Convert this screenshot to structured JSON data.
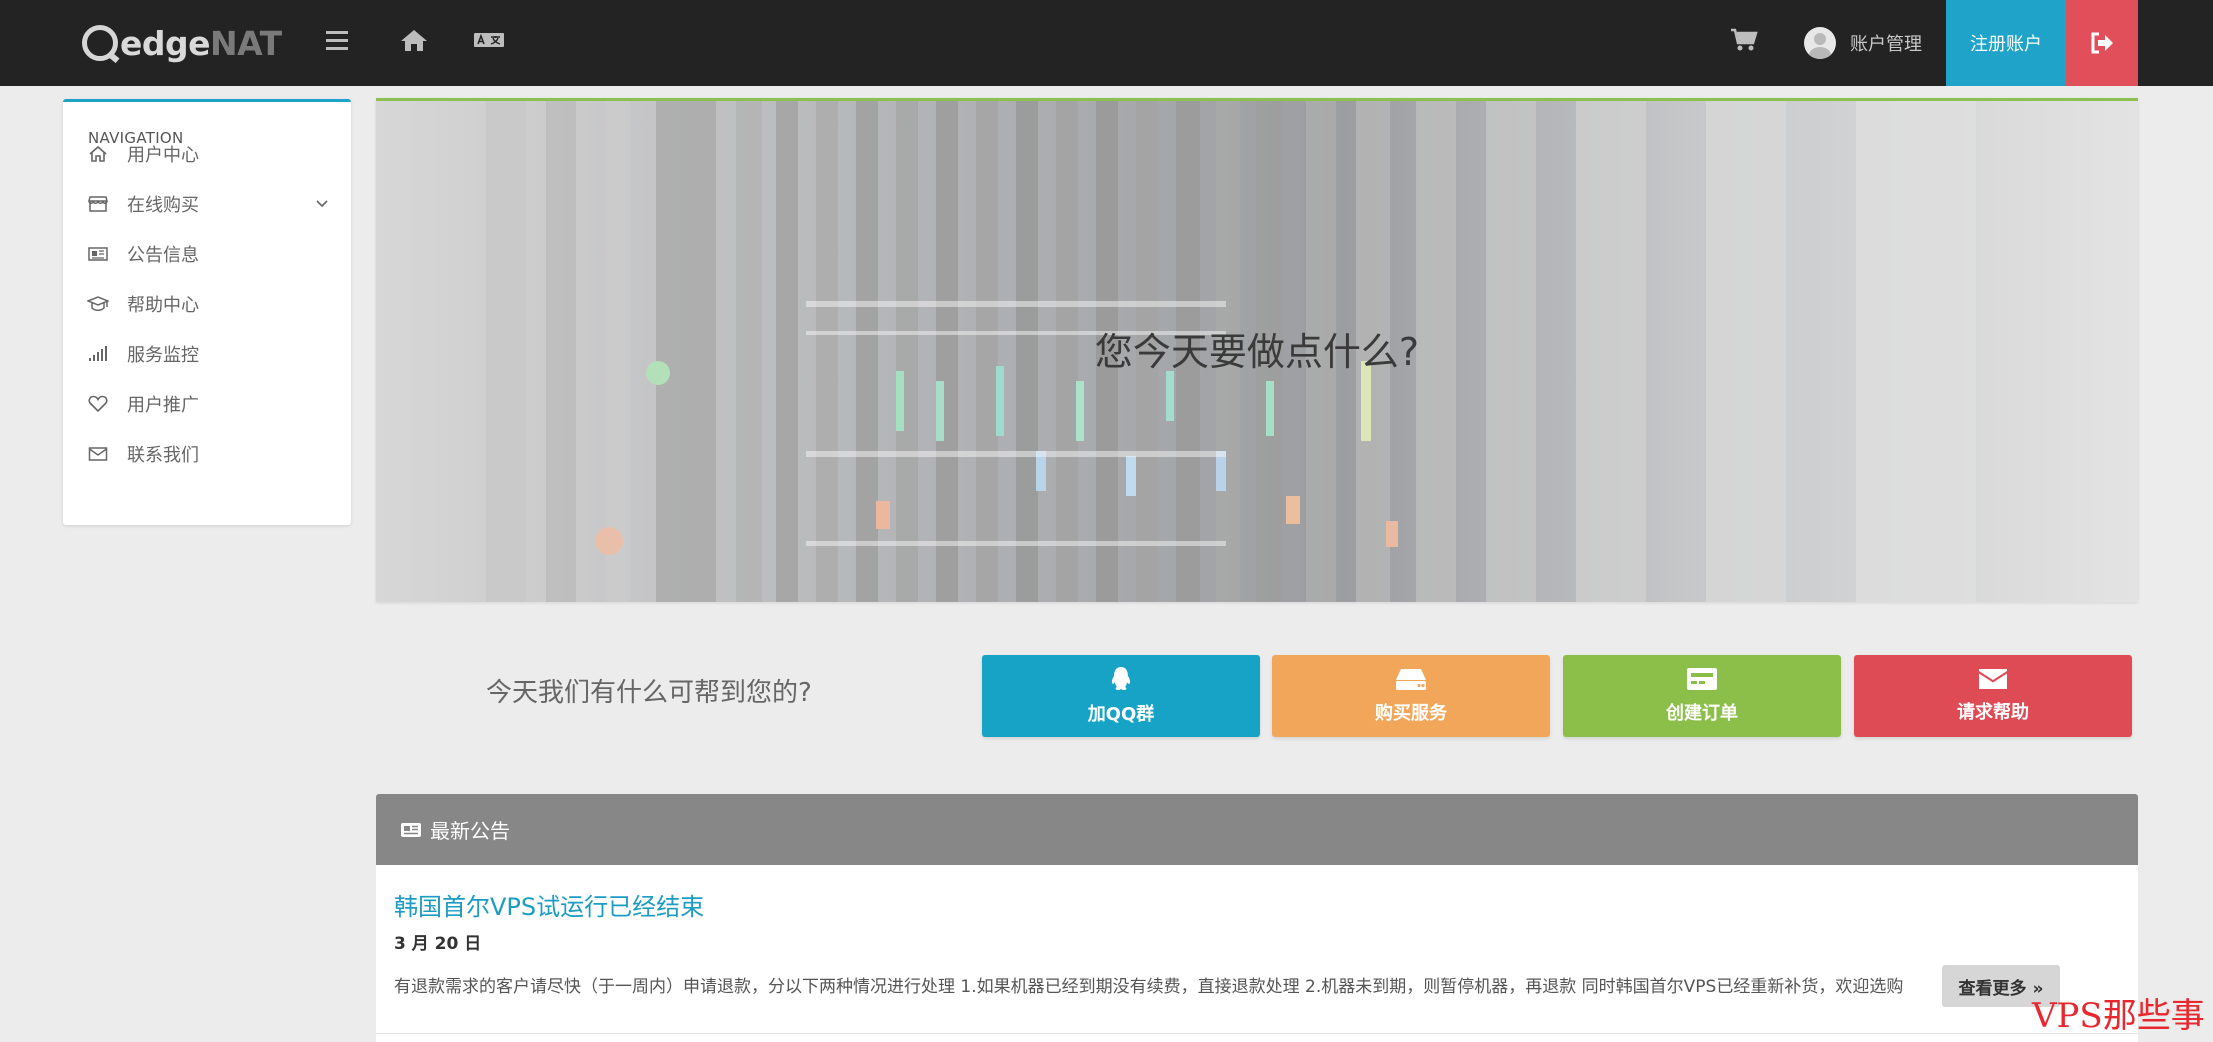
{
  "brand": {
    "logo_main": "edge",
    "logo_accent": "NAT"
  },
  "topbar": {
    "account_label": "账户管理",
    "register_label": "注册账户"
  },
  "colors": {
    "topbar": "#232323",
    "primary_blue": "#1fa3c8",
    "orange": "#f2a65a",
    "green": "#8cbf4a",
    "red": "#de4b54"
  },
  "sidebar": {
    "heading": "NAVIGATION",
    "items": [
      {
        "label": "用户中心",
        "icon": "home-outline-icon"
      },
      {
        "label": "在线购买",
        "icon": "store-icon",
        "expandable": true
      },
      {
        "label": "公告信息",
        "icon": "newspaper-icon"
      },
      {
        "label": "帮助中心",
        "icon": "graduation-cap-icon"
      },
      {
        "label": "服务监控",
        "icon": "signal-bars-icon"
      },
      {
        "label": "用户推广",
        "icon": "heart-icon"
      },
      {
        "label": "联系我们",
        "icon": "envelope-icon"
      }
    ]
  },
  "hero": {
    "title": "您今天要做点什么?"
  },
  "help": {
    "prompt": "今天我们有什么可帮到您的?",
    "actions": [
      {
        "label": "加QQ群",
        "icon": "qq-penguin-icon"
      },
      {
        "label": "购买服务",
        "icon": "server-icon"
      },
      {
        "label": "创建订单",
        "icon": "credit-card-icon"
      },
      {
        "label": "请求帮助",
        "icon": "envelope-icon"
      }
    ]
  },
  "announcements": {
    "header": "最新公告",
    "items": [
      {
        "title": "韩国首尔VPS试运行已经结束",
        "date": "3 月 20 日",
        "excerpt": "有退款需求的客户请尽快（于一周内）申请退款，分以下两种情况进行处理 1.如果机器已经到期没有续费，直接退款处理 2.机器未到期，则暂停机器，再退款 同时韩国首尔VPS已经重新补货，欢迎选购",
        "more_label": "查看更多 »"
      }
    ]
  },
  "watermark": "VPS那些事"
}
